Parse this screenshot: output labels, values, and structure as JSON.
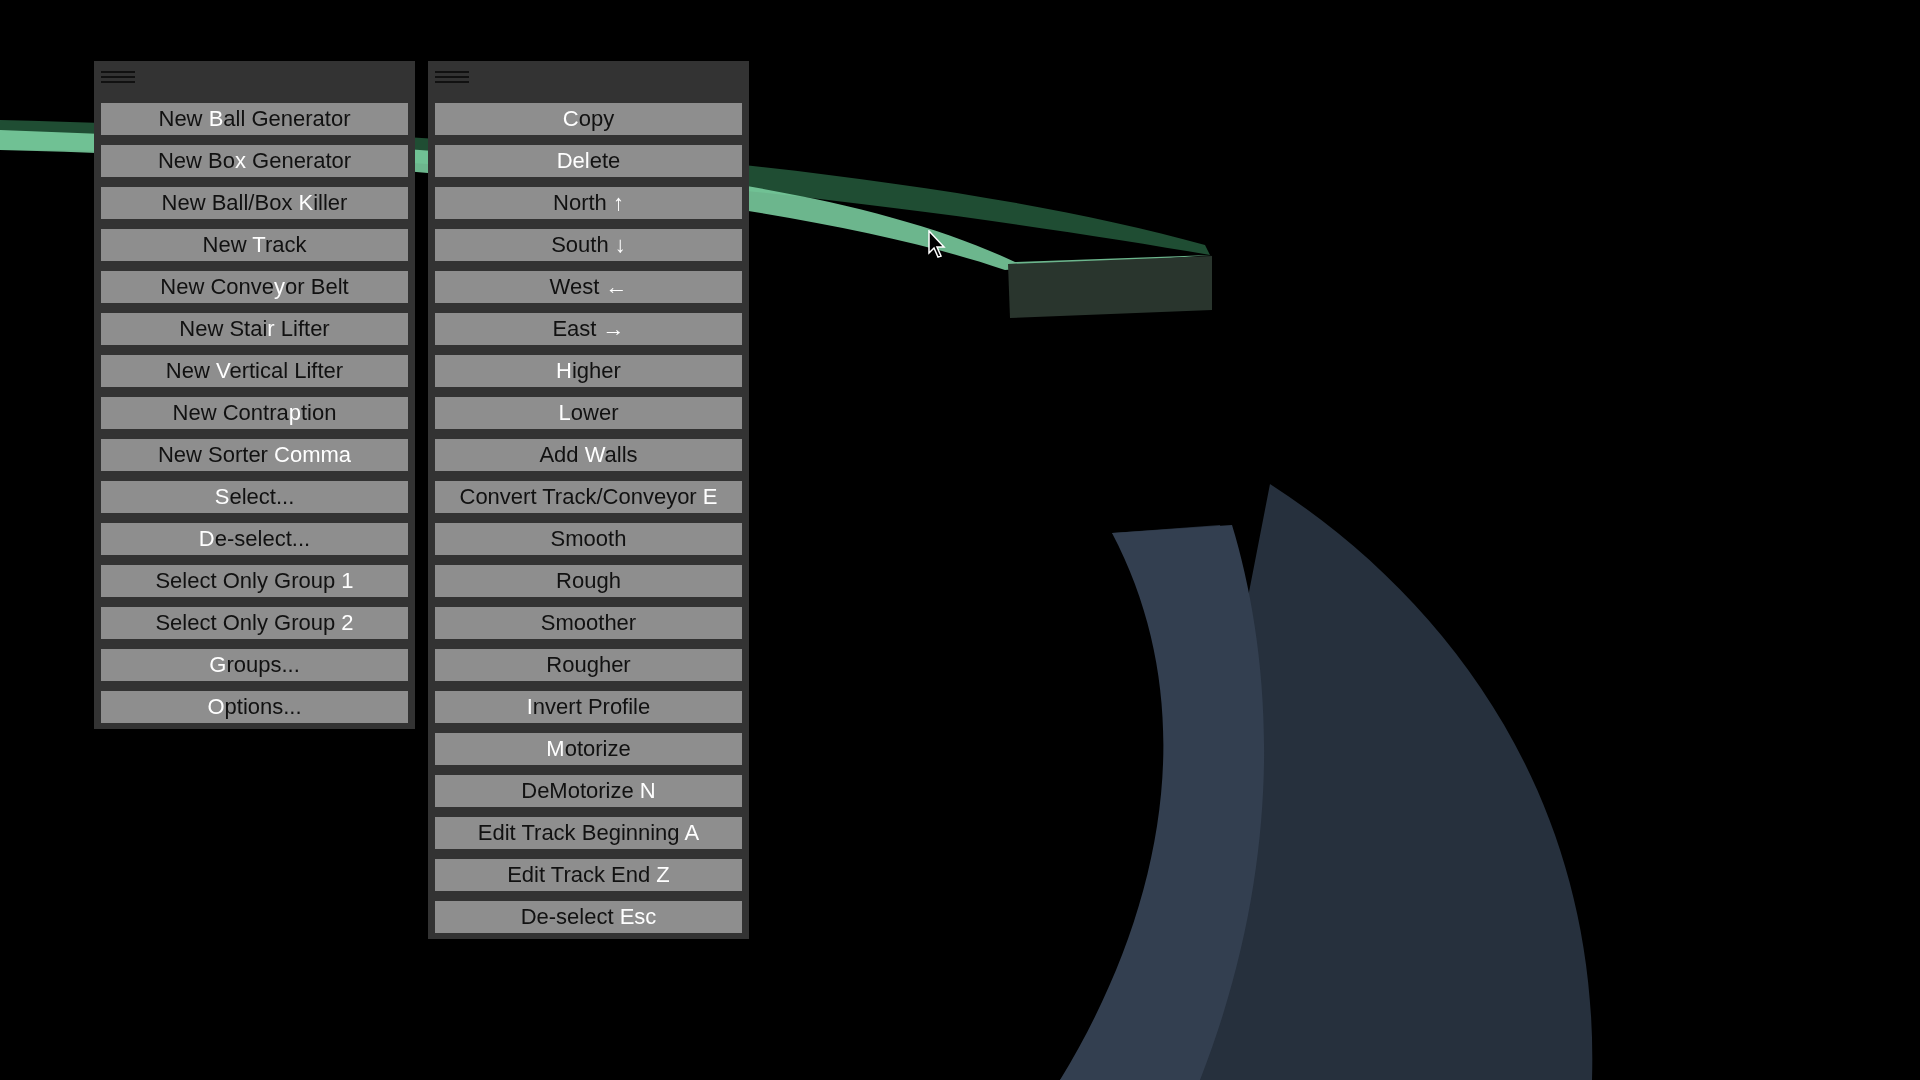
{
  "panels": [
    {
      "buttons": [
        {
          "before": "New ",
          "key": "B",
          "after": "all Generator"
        },
        {
          "before": "New Bo",
          "key": "x",
          "after": " Generator"
        },
        {
          "before": "New Ball/Box ",
          "key": "K",
          "after": "iller"
        },
        {
          "before": "New ",
          "key": "T",
          "after": "rack"
        },
        {
          "before": "New Conve",
          "key": "y",
          "after": "or Belt"
        },
        {
          "before": "New Stai",
          "key": "r",
          "after": " Lifter"
        },
        {
          "before": "New ",
          "key": "V",
          "after": "ertical Lifter"
        },
        {
          "before": "New Contra",
          "key": "p",
          "after": "tion"
        },
        {
          "before": "New Sorter ",
          "key": "Comma"
        },
        {
          "key": "S",
          "after": "elect..."
        },
        {
          "key": "D",
          "after": "e-select..."
        },
        {
          "before": "Select Only Group ",
          "key": "1"
        },
        {
          "before": "Select Only Group ",
          "key": "2"
        },
        {
          "key": "G",
          "after": "roups..."
        },
        {
          "key": "O",
          "after": "ptions..."
        }
      ]
    },
    {
      "buttons": [
        {
          "key": "C",
          "after": "opy"
        },
        {
          "key": "Del",
          "after": "ete"
        },
        {
          "before": "North ",
          "key": "↑"
        },
        {
          "before": "South ",
          "key": "↓"
        },
        {
          "before": "West ",
          "key": "←"
        },
        {
          "before": "East ",
          "key": "→"
        },
        {
          "key": "H",
          "after": "igher"
        },
        {
          "key": "L",
          "after": "ower"
        },
        {
          "before": "Add ",
          "key": "W",
          "after": "alls"
        },
        {
          "before": "Convert Track/Conveyor ",
          "key": "E"
        },
        {
          "before": "Smooth"
        },
        {
          "before": "Rough"
        },
        {
          "before": "Smoother"
        },
        {
          "before": "Rougher"
        },
        {
          "key": "I",
          "after": "nvert Profile"
        },
        {
          "key": "M",
          "after": "otorize"
        },
        {
          "before": "DeMotorize ",
          "key": "N"
        },
        {
          "before": "Edit Track Beginning ",
          "key": "A"
        },
        {
          "before": "Edit Track End ",
          "key": "Z"
        },
        {
          "before": "De-select ",
          "key": "Esc"
        }
      ]
    }
  ]
}
